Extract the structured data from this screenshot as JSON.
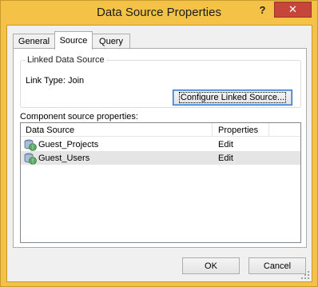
{
  "window": {
    "title": "Data Source Properties",
    "help_label": "?",
    "close_label": "✕"
  },
  "tabs": [
    {
      "label": "General",
      "active": false
    },
    {
      "label": "Source",
      "active": true
    },
    {
      "label": "Query",
      "active": false
    }
  ],
  "linked_source": {
    "group_label": "Linked Data Source",
    "link_type": "Link Type: Join",
    "configure_button": "Configure Linked Source..."
  },
  "component": {
    "label": "Component source properties:",
    "columns": [
      "Data Source",
      "Properties"
    ],
    "rows": [
      {
        "data_source": "Guest_Projects",
        "properties": "Edit",
        "icon": "database-globe-icon"
      },
      {
        "data_source": "Guest_Users",
        "properties": "Edit",
        "icon": "database-globe-icon"
      }
    ]
  },
  "buttons": {
    "ok": "OK",
    "cancel": "Cancel"
  }
}
